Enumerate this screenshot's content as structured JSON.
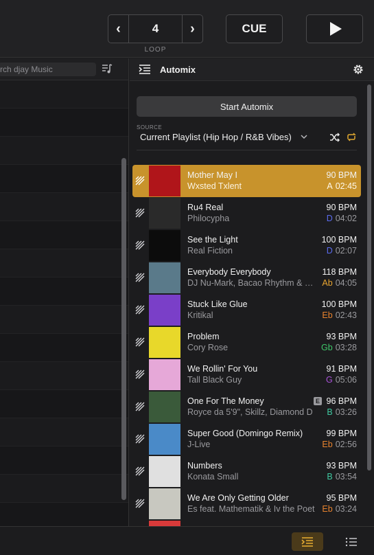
{
  "transport": {
    "loop_value": "4",
    "loop_label": "LOOP",
    "cue_label": "CUE"
  },
  "library": {
    "search_placeholder": "rch djay Music"
  },
  "automix": {
    "title": "Automix",
    "start_label": "Start Automix",
    "source_label": "SOURCE",
    "source_value": "Current Playlist (Hip Hop / R&B Vibes)",
    "accent_color": "#c8932c"
  },
  "tracks": [
    {
      "title": "Mother May I",
      "artist": "Wxsted Txlent",
      "bpm": "90 BPM",
      "key": "A",
      "key_color": "#fff8ea",
      "time": "02:45",
      "explicit": false,
      "active": true,
      "art": "#b0151a"
    },
    {
      "title": "Ru4 Real",
      "artist": "Philocypha",
      "bpm": "90 BPM",
      "key": "D",
      "key_color": "#5b6cf0",
      "time": "04:02",
      "explicit": false,
      "active": false,
      "art": "#2a2a2a"
    },
    {
      "title": "See the Light",
      "artist": "Real Fiction",
      "bpm": "100 BPM",
      "key": "D",
      "key_color": "#5b6cf0",
      "time": "02:07",
      "explicit": false,
      "active": false,
      "art": "#0c0c0c"
    },
    {
      "title": "Everybody Everybody",
      "artist": "DJ Nu-Mark, Bacao Rhythm & Steel Band",
      "bpm": "118 BPM",
      "key": "Ab",
      "key_color": "#e8a531",
      "time": "04:05",
      "explicit": false,
      "active": false,
      "art": "#5a7a8a"
    },
    {
      "title": "Stuck Like Glue",
      "artist": "Kritikal",
      "bpm": "100 BPM",
      "key": "Eb",
      "key_color": "#e8832e",
      "time": "02:43",
      "explicit": false,
      "active": false,
      "art": "#7a3fc8"
    },
    {
      "title": "Problem",
      "artist": "Cory Rose",
      "bpm": "93 BPM",
      "key": "Gb",
      "key_color": "#3fc86a",
      "time": "03:28",
      "explicit": false,
      "active": false,
      "art": "#e8d82a"
    },
    {
      "title": "We Rollin' For You",
      "artist": "Tall Black Guy",
      "bpm": "91 BPM",
      "key": "G",
      "key_color": "#a852d8",
      "time": "05:06",
      "explicit": false,
      "active": false,
      "art": "#e6a8d8"
    },
    {
      "title": "One For The Money",
      "artist": "Royce da 5'9\", Skillz, Diamond D",
      "bpm": "96 BPM",
      "key": "B",
      "key_color": "#3fc8a0",
      "time": "03:26",
      "explicit": true,
      "explicit_label": "E",
      "active": false,
      "art": "#3a5a3a"
    },
    {
      "title": "Super Good (Domingo Remix)",
      "artist": "J-Live",
      "bpm": "99 BPM",
      "key": "Eb",
      "key_color": "#e8832e",
      "time": "02:56",
      "explicit": false,
      "active": false,
      "art": "#4a8ac8"
    },
    {
      "title": "Numbers",
      "artist": "Konata Small",
      "bpm": "93 BPM",
      "key": "B",
      "key_color": "#3fc8a0",
      "time": "03:54",
      "explicit": false,
      "active": false,
      "art": "#e0e0e0"
    },
    {
      "title": "We Are Only Getting Older",
      "artist": "Es feat. Mathematik & Iv the Poet",
      "bpm": "95 BPM",
      "key": "Eb",
      "key_color": "#e8832e",
      "time": "03:24",
      "explicit": false,
      "active": false,
      "art": "#c8c8c0"
    },
    {
      "title": "",
      "artist": "",
      "bpm": "",
      "key": "",
      "key_color": "#9a9a9e",
      "time": "",
      "explicit": false,
      "active": false,
      "art": "#d83a3a"
    }
  ]
}
